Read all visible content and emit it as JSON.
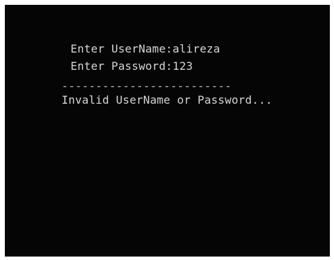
{
  "console": {
    "username_prompt": "Enter UserName:alireza",
    "password_prompt": "Enter Password:123",
    "separator": "-------------------------",
    "error_message": "Invalid UserName or Password..."
  }
}
